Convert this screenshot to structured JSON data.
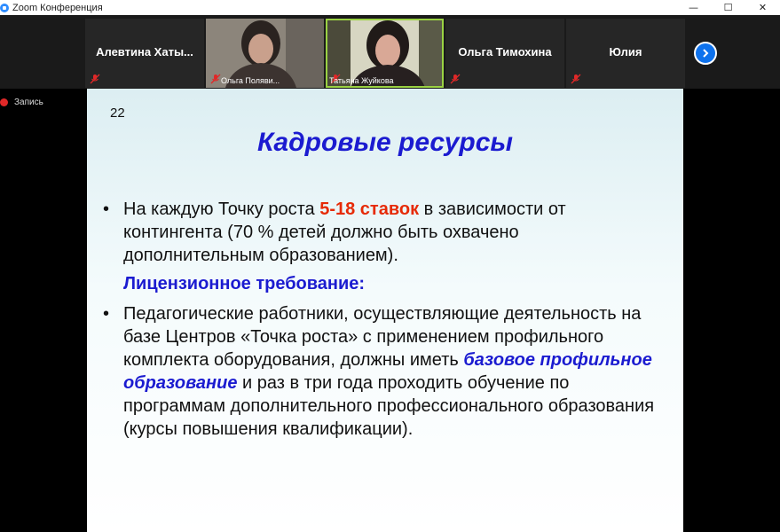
{
  "window": {
    "title": "Zoom Конференция",
    "minimize": "—",
    "maximize": "☐",
    "close": "✕"
  },
  "participants": [
    {
      "name": "Алевтина  Хаты...",
      "type": "name"
    },
    {
      "name": "Ольга Поляви...",
      "type": "video"
    },
    {
      "name": "Татьяна Жуйкова",
      "type": "video",
      "active": true
    },
    {
      "name": "Ольга Тимохина",
      "type": "name"
    },
    {
      "name": "Юлия",
      "type": "name"
    }
  ],
  "recording": {
    "label": "Запись"
  },
  "slide": {
    "number": "22",
    "title": "Кадровые ресурсы",
    "bullet1": {
      "pre": "На каждую Точку роста ",
      "highlight": "5-18 ставок",
      "post": " в зависимости от контингента (70 % детей должно быть охвачено дополнительным образованием)."
    },
    "requirement": "Лицензионное требование:",
    "bullet2": {
      "pre": "Педагогические работники, осуществляющие деятельность на базе Центров «Точка роста» с применением профильного комплекта оборудования, должны иметь ",
      "highlight": "базовое профильное образование",
      "post": " и раз в три года проходить обучение по программам дополнительного профессионального образования (курсы повышения квалификации)."
    }
  },
  "colors": {
    "title_blue": "#1b1bd0",
    "highlight_red": "#e62a06",
    "active_speaker": "#9ad243",
    "zoom_blue": "#0e72ed"
  }
}
